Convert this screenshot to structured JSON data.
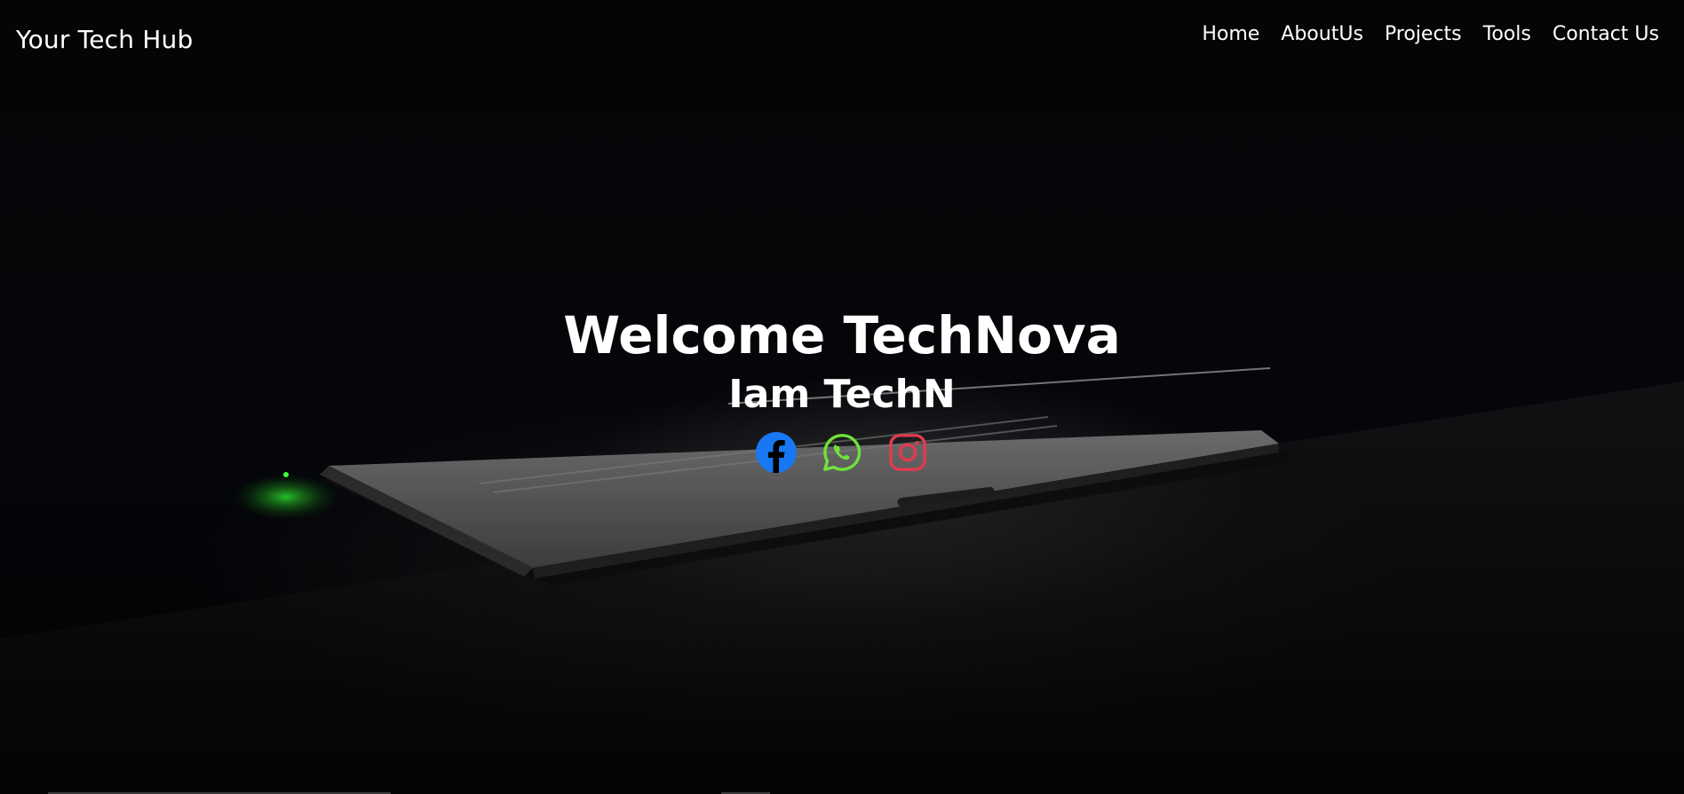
{
  "navbar": {
    "brand": "Your Tech Hub",
    "links": [
      "Home",
      "AboutUs",
      "Projects",
      "Tools",
      "Contact Us"
    ]
  },
  "hero": {
    "title": "Welcome TechNova",
    "subtitle": "Iam TechN"
  },
  "social": [
    {
      "icon": "facebook-icon",
      "color": "#1877f2"
    },
    {
      "icon": "whatsapp-icon",
      "color": "#6fe33a"
    },
    {
      "icon": "instagram-icon",
      "color": "#e03a4f"
    }
  ],
  "colors": {
    "background": "#05060a",
    "text": "#ffffff"
  }
}
